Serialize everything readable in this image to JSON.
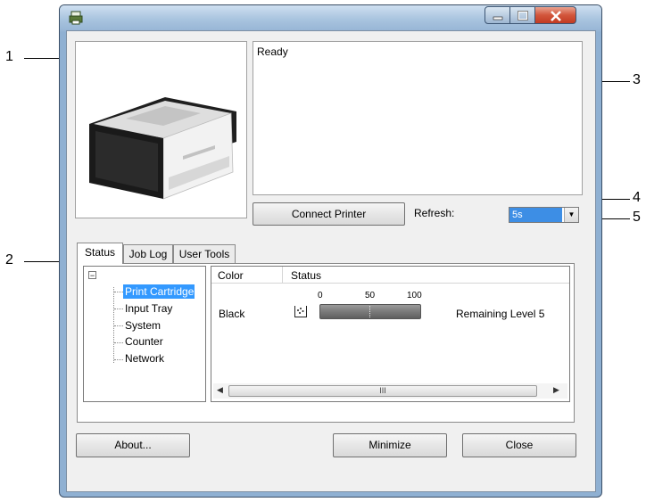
{
  "callouts": {
    "c1": "1",
    "c2": "2",
    "c3": "3",
    "c4": "4",
    "c5": "5"
  },
  "window": {
    "icons": {
      "app": "printer-app-icon",
      "minimize": "minimize-icon",
      "maximize": "maximize-icon",
      "close": "close-icon"
    }
  },
  "status_message": "Ready",
  "connect_button": "Connect Printer",
  "refresh": {
    "label": "Refresh:",
    "value": "5s"
  },
  "tabs": [
    {
      "label": "Status",
      "active": true
    },
    {
      "label": "Job Log",
      "active": false
    },
    {
      "label": "User Tools",
      "active": false
    }
  ],
  "tree": {
    "toggle": "−",
    "items": [
      "Print Cartridge",
      "Input Tray",
      "System",
      "Counter",
      "Network"
    ],
    "selected": 0
  },
  "list": {
    "columns": [
      "Color",
      "Status"
    ],
    "scale_ticks": [
      "0",
      "50",
      "100"
    ],
    "rows": [
      {
        "color": "Black",
        "remaining": "Remaining Level 5",
        "level_fraction": 1.0
      }
    ],
    "scroll_thumb": "III"
  },
  "buttons": {
    "about": "About...",
    "minimize": "Minimize",
    "close": "Close"
  },
  "colors": {
    "selection": "#3399ff",
    "titlebar": "#a9c4df",
    "close_button": "#c13a22"
  }
}
